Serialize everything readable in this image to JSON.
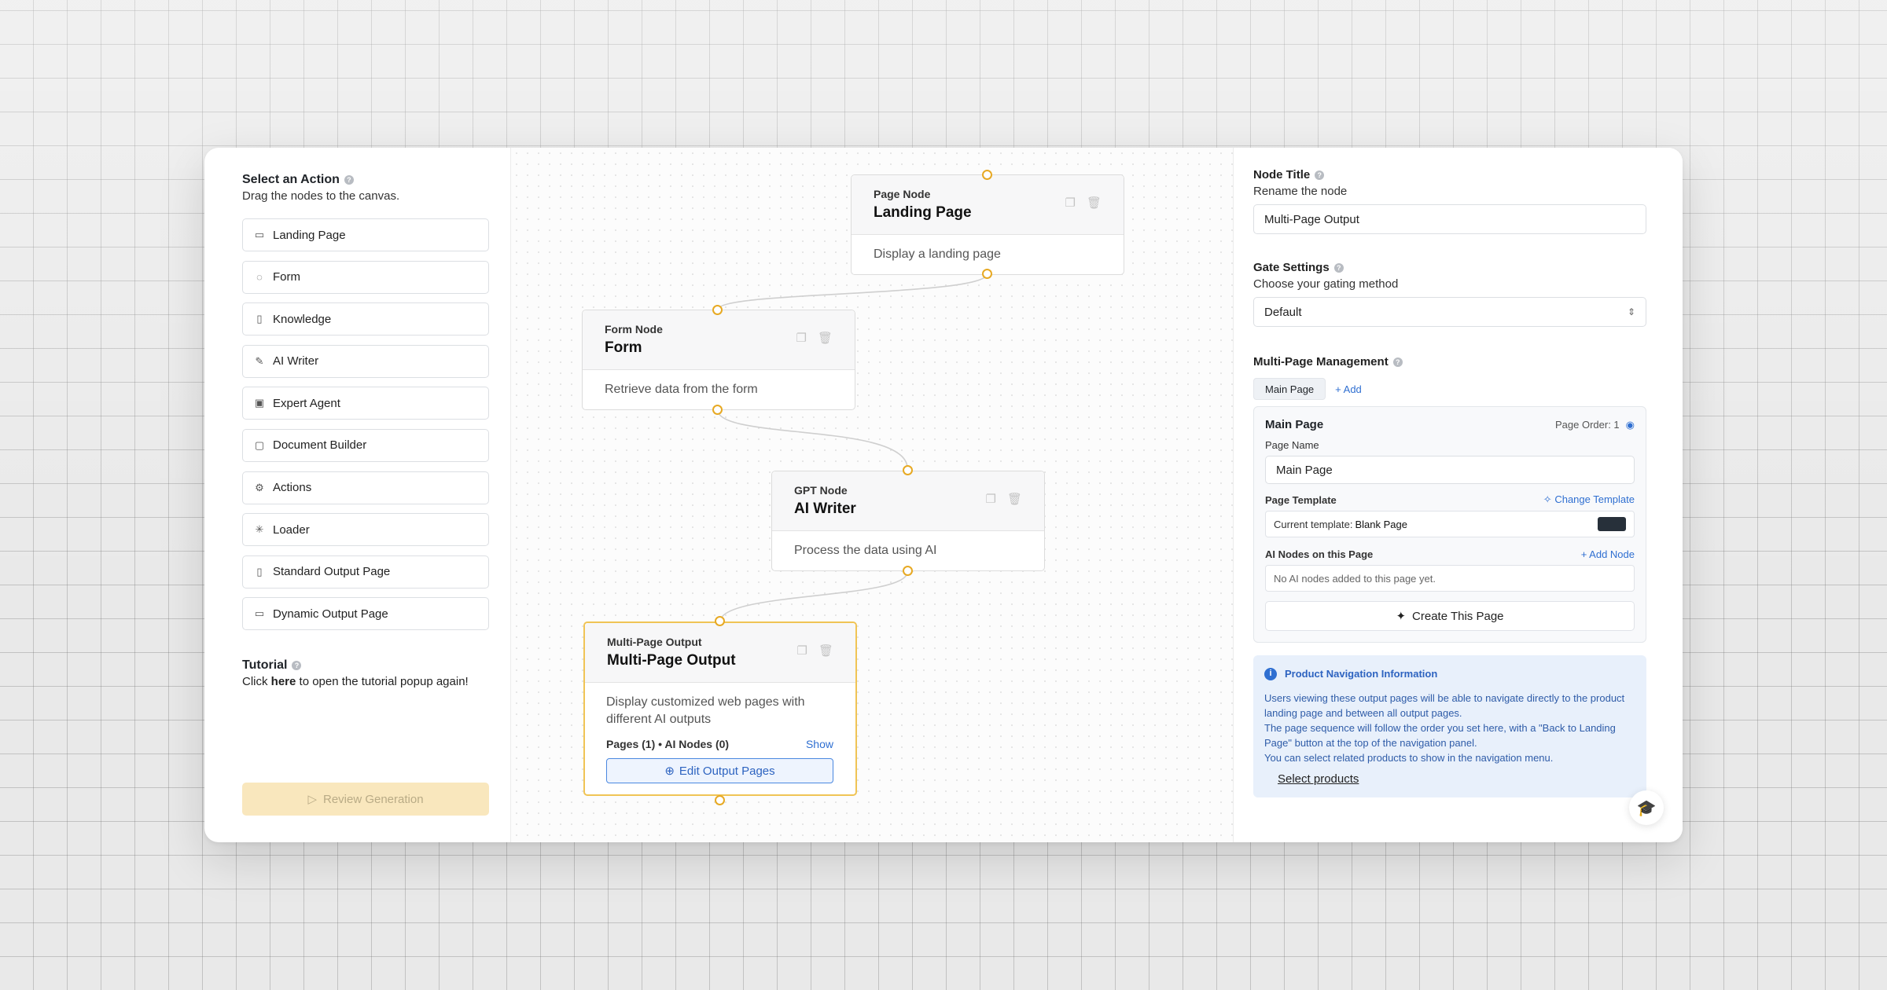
{
  "sidebar": {
    "title": "Select an Action",
    "subtitle": "Drag the nodes to the canvas.",
    "items": [
      {
        "label": "Landing Page",
        "icon": "monitor-icon"
      },
      {
        "label": "Form",
        "icon": "chat-icon"
      },
      {
        "label": "Knowledge",
        "icon": "book-icon"
      },
      {
        "label": "AI Writer",
        "icon": "pencil-icon"
      },
      {
        "label": "Expert Agent",
        "icon": "cpu-icon"
      },
      {
        "label": "Document Builder",
        "icon": "file-icon"
      },
      {
        "label": "Actions",
        "icon": "gear-icon"
      },
      {
        "label": "Loader",
        "icon": "loader-icon"
      },
      {
        "label": "Standard Output Page",
        "icon": "clipboard-icon"
      },
      {
        "label": "Dynamic Output Page",
        "icon": "monitor-icon"
      }
    ],
    "tutorial_title": "Tutorial",
    "tutorial_prefix": "Click ",
    "tutorial_link": "here",
    "tutorial_suffix": " to open the tutorial popup again!",
    "review_label": "Review Generation"
  },
  "canvas": {
    "nodes": [
      {
        "kind": "Page Node",
        "title": "Landing Page",
        "desc": "Display a landing page"
      },
      {
        "kind": "Form Node",
        "title": "Form",
        "desc": "Retrieve data from the form"
      },
      {
        "kind": "GPT Node",
        "title": "AI Writer",
        "desc": "Process the data using AI"
      },
      {
        "kind": "Multi-Page Output",
        "title": "Multi-Page Output",
        "desc": "Display customized web pages with different AI outputs",
        "pages_info": "Pages (1) • AI Nodes (0)",
        "show_label": "Show",
        "edit_label": "Edit Output Pages"
      }
    ]
  },
  "panel": {
    "node_title_label": "Node Title",
    "node_title_sub": "Rename the node",
    "node_title_value": "Multi-Page Output",
    "gate_label": "Gate Settings",
    "gate_sub": "Choose your gating method",
    "gate_value": "Default",
    "mpm_label": "Multi-Page Management",
    "tab_main": "Main Page",
    "tab_add": "+ Add",
    "card": {
      "title": "Main Page",
      "page_order": "Page Order: 1",
      "page_name_label": "Page Name",
      "page_name_value": "Main Page",
      "template_label": "Page Template",
      "change_template": "Change Template",
      "current_template_prefix": "Current template: ",
      "current_template_value": "Blank Page",
      "ai_nodes_label": "AI Nodes on this Page",
      "add_node": "+ Add Node",
      "no_nodes": "No AI nodes added to this page yet.",
      "create_label": "Create This Page"
    },
    "info": {
      "title": "Product Navigation Information",
      "line1": "Users viewing these output pages will be able to navigate directly to the product landing page and between all output pages.",
      "line2": "The page sequence will follow the order you set here, with a \"Back to Landing Page\" button at the top of the navigation panel.",
      "line3": "You can select related products to show in the navigation menu.",
      "link": "Select products"
    }
  },
  "colors": {
    "accent": "#e7a923",
    "link": "#2f6fd1",
    "review_bg": "#f9e7bd"
  }
}
